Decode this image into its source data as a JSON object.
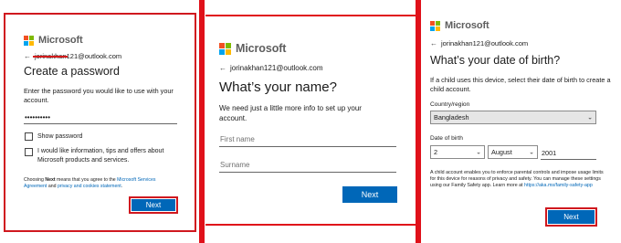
{
  "brand": {
    "name": "Microsoft",
    "colors": {
      "red": "#f25022",
      "green": "#7fba00",
      "blue": "#00a4ef",
      "yellow": "#ffb900"
    }
  },
  "accent": "#0067b8",
  "panel1": {
    "email": "jorinakhan121@outlook.com",
    "title": "Create a password",
    "description": "Enter the password you would like to use with your account.",
    "password_mask": "••••••••••",
    "show_password_label": "Show password",
    "promo_label": "I would like information, tips and offers about Microsoft products and services.",
    "legal_prefix": "Choosing ",
    "legal_bold": "Next",
    "legal_middle": " means that you agree to the ",
    "legal_link1": "Microsoft Services Agreement",
    "legal_and": " and ",
    "legal_link2": "privacy and cookies statement",
    "legal_end": ".",
    "next_label": "Next"
  },
  "panel2": {
    "email": "jorinakhan121@outlook.com",
    "title": "What’s your name?",
    "description": "We need just a little more info to set up your account.",
    "first_name_placeholder": "First name",
    "surname_placeholder": "Surname",
    "next_label": "Next"
  },
  "panel3": {
    "email": "jorinakhan121@outlook.com",
    "title": "What’s your date of birth?",
    "description": "If a child uses this device, select their date of birth to create a child account.",
    "country_label": "Country/region",
    "country_value": "Bangladesh",
    "dob_label": "Date of birth",
    "day_value": "2",
    "month_value": "August",
    "year_value": "2001",
    "note": "A child account enables you to enforce parental controls and impose usage limits for this device for reasons of privacy and safety. You can manage these settings using our Family Safety app. Learn more at ",
    "note_link": "https://aka.ms/family-safety-app",
    "next_label": "Next"
  }
}
